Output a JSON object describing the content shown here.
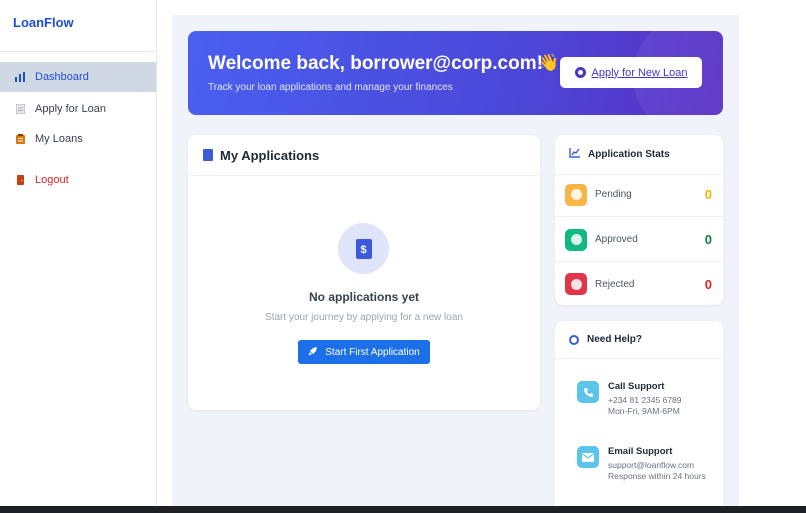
{
  "sidebar": {
    "brand": "LoanFlow",
    "items": [
      {
        "label": "Dashboard",
        "icon": "bar-chart-icon"
      },
      {
        "label": "Apply for Loan",
        "icon": "document-icon"
      },
      {
        "label": "My Loans",
        "icon": "clipboard-icon"
      },
      {
        "label": "Logout",
        "icon": "door-icon"
      }
    ]
  },
  "hero": {
    "title": "Welcome back, borrower@corp.com!",
    "emoji": "👋",
    "subtitle": "Track your loan applications and manage your finances",
    "button_label": "Apply for New Loan"
  },
  "applications": {
    "title": "My Applications",
    "empty_title": "No applications yet",
    "empty_subtitle": "Start your journey by applying for a new loan",
    "button_label": "Start First Application"
  },
  "stats": {
    "title": "Application Stats",
    "rows": [
      {
        "label": "Pending",
        "value": "0",
        "color": "#f5b301",
        "badge": "#f6b545"
      },
      {
        "label": "Approved",
        "value": "0",
        "color": "#15803d",
        "badge": "#10b981"
      },
      {
        "label": "Rejected",
        "value": "0",
        "color": "#dc2626",
        "badge": "#e0364a"
      }
    ]
  },
  "help": {
    "title": "Need Help?",
    "call": {
      "title": "Call Support",
      "phone": "+234 81 2345 6789",
      "hours": "Mon-Fri, 9AM-6PM"
    },
    "email": {
      "title": "Email Support",
      "address": "support@loanflow.com",
      "note": "Response within 24 hours"
    }
  },
  "colors": {
    "accent": "#1d4ed8",
    "hero_start": "#4a5ff0",
    "hero_end": "#5a2fc4",
    "primary_button": "#1d6fe8"
  }
}
